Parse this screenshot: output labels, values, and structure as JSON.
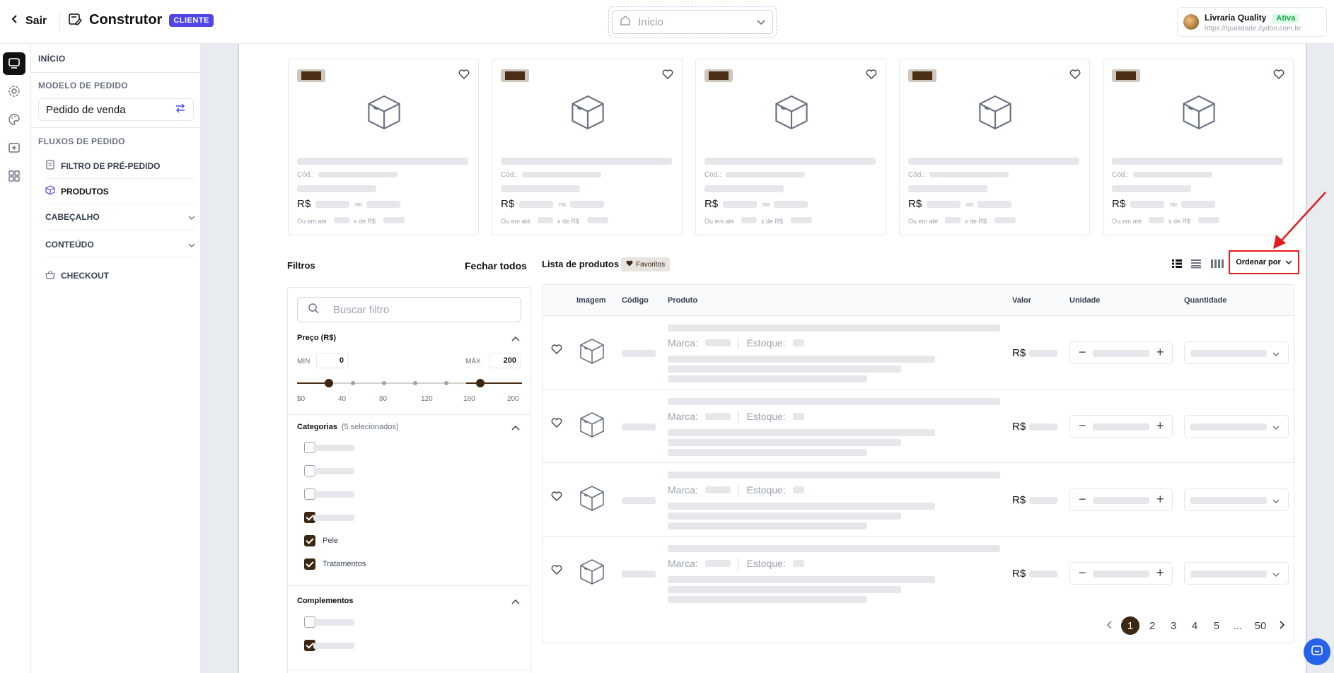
{
  "header": {
    "back_label": "Sair",
    "builder_title": "Construtor",
    "badge": "CLIENTE",
    "page_select": "Início",
    "store": {
      "name": "Livraria Quality",
      "status": "Ativa",
      "url": "https://qualidade.zydon.com.br"
    }
  },
  "sidebar": {
    "start": "INÍCIO",
    "order_model_heading": "MODELO DE PEDIDO",
    "order_model_value": "Pedido de venda",
    "flows_heading": "FLUXOS DE PEDIDO",
    "flows": [
      {
        "label": "FILTRO DE PRÉ-PEDIDO"
      },
      {
        "label": "PRODUTOS"
      },
      {
        "label": "CABEÇALHO"
      },
      {
        "label": "CONTEÚDO"
      },
      {
        "label": "CHECKOUT"
      }
    ]
  },
  "cards": {
    "cod_label": "Cód.:",
    "currency": "R$",
    "no_label": "no",
    "installment_prefix": "Ou em até",
    "installment_mid": "x de R$"
  },
  "filters": {
    "title": "Filtros",
    "close_all": "Fechar todos",
    "search_placeholder": "Buscar filtro",
    "price": {
      "heading": "Preço (R$)",
      "min_label": "MIN",
      "max_label": "MÁX",
      "min_value": "0",
      "max_value": "200",
      "ticks": [
        "$0",
        "40",
        "80",
        "120",
        "160",
        "200"
      ]
    },
    "categories": {
      "heading": "Categorias",
      "selected_note": "(5 selecionados)",
      "items": [
        {
          "label": "",
          "checked": false
        },
        {
          "label": "",
          "checked": false
        },
        {
          "label": "",
          "checked": false
        },
        {
          "label": "",
          "checked": true
        },
        {
          "label": "Pele",
          "checked": true
        },
        {
          "label": "Tratamentos",
          "checked": true
        }
      ]
    },
    "complements": {
      "heading": "Complementos",
      "items": [
        {
          "label": "",
          "checked": false
        },
        {
          "label": "",
          "checked": true
        }
      ]
    }
  },
  "product_list": {
    "title": "Lista de produtos",
    "favorites": "Favoritos",
    "order_by": "Ordenar por",
    "columns": [
      "Imagem",
      "Código",
      "Produto",
      "Valor",
      "Unidade",
      "Quantidade"
    ],
    "brand_label": "Marca:",
    "stock_label": "Estoque:",
    "currency": "R$",
    "pagination": {
      "pages": [
        "1",
        "2",
        "3",
        "4",
        "5",
        "...",
        "50"
      ],
      "current": "1"
    }
  }
}
